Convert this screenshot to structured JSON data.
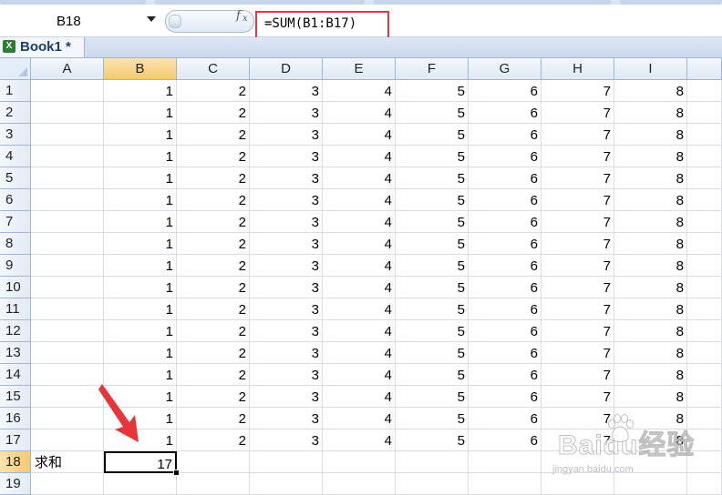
{
  "name_box": {
    "value": "B18"
  },
  "formula_bar": {
    "fx_label": "fx",
    "formula": "=SUM(B1:B17)"
  },
  "workbook_tab": {
    "name": "Book1 *"
  },
  "columns": [
    "A",
    "B",
    "C",
    "D",
    "E",
    "F",
    "G",
    "H",
    "I"
  ],
  "rows": [
    "1",
    "2",
    "3",
    "4",
    "5",
    "6",
    "7",
    "8",
    "9",
    "10",
    "11",
    "12",
    "13",
    "14",
    "15",
    "16",
    "17",
    "18",
    "19"
  ],
  "data_row_values": [
    "1",
    "2",
    "3",
    "4",
    "5",
    "6",
    "7",
    "8"
  ],
  "row18": {
    "label": "求和",
    "sum": "17"
  },
  "active_cell": "B18",
  "annotation": {
    "arrow_color": "#e8353a",
    "highlight_color": "#dc3c45"
  },
  "watermark": {
    "brand": "Baidu经验",
    "url": "jingyan.baidu.com"
  }
}
